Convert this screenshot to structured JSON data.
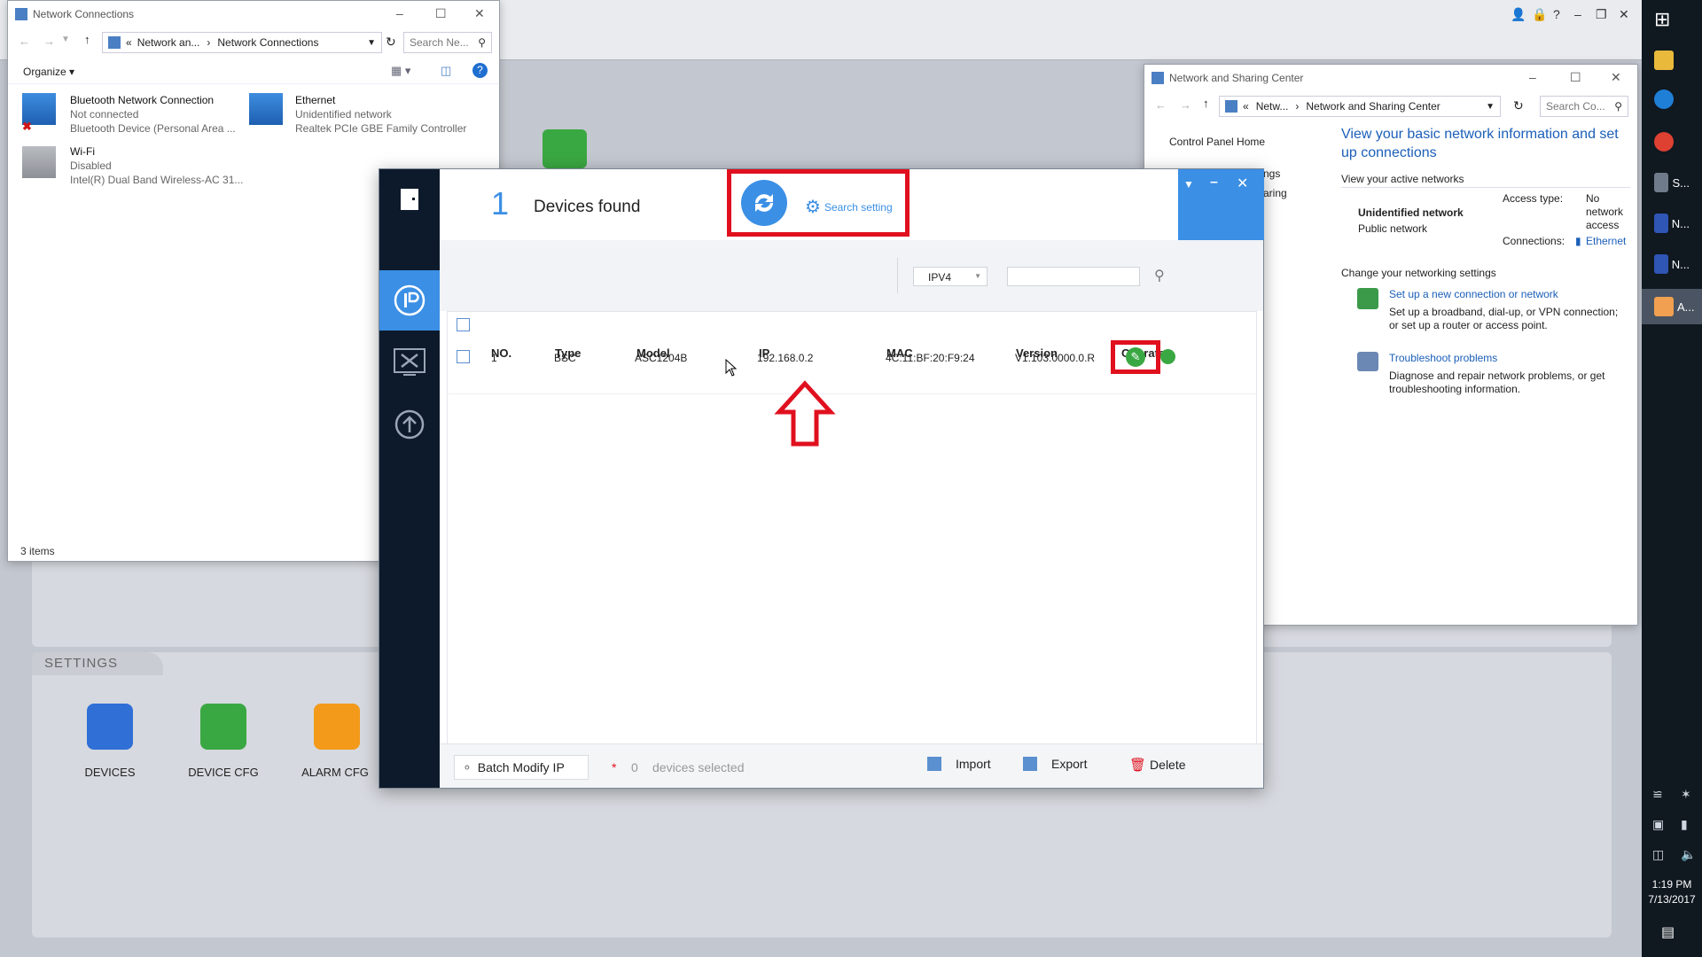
{
  "network_connections": {
    "title": "Network Connections",
    "breadcrumb_prefix": "«",
    "breadcrumb_1": "Network an...",
    "breadcrumb_2": "Network Connections",
    "search_placeholder": "Search Ne...",
    "organize": "Organize",
    "items": [
      {
        "name": "Bluetooth Network Connection",
        "status": "Not connected",
        "device": "Bluetooth Device (Personal Area ..."
      },
      {
        "name": "Ethernet",
        "status": "Unidentified network",
        "device": "Realtek PCIe GBE Family Controller"
      },
      {
        "name": "Wi-Fi",
        "status": "Disabled",
        "device": "Intel(R) Dual Band Wireless-AC 31..."
      }
    ],
    "status_bar": "3 items"
  },
  "sharing_center": {
    "title": "Network and Sharing Center",
    "breadcrumb_prefix": "«",
    "breadcrumb_1": "Netw...",
    "breadcrumb_2": "Network and Sharing Center",
    "search_placeholder": "Search Co...",
    "sidebar_home": "Control Panel Home",
    "sidebar_partial_1": "ngs",
    "sidebar_partial_2": "aring",
    "heading": "View your basic network information and set up connections",
    "active_networks": "View your active networks",
    "network_name": "Unidentified network",
    "network_type": "Public network",
    "access_type_label": "Access type:",
    "access_type_value": "No network access",
    "connections_label": "Connections:",
    "connections_value": "Ethernet",
    "change_settings": "Change your networking settings",
    "setup_link": "Set up a new connection or network",
    "setup_desc": "Set up a broadband, dial-up, or VPN connection; or set up a router or access point.",
    "trouble_link": "Troubleshoot problems",
    "trouble_desc": "Diagnose and repair network problems, or get troubleshooting information."
  },
  "background_app": {
    "settings_label": "SETTINGS",
    "icons": [
      {
        "label": "DEVICES",
        "color": "#2f6fd6"
      },
      {
        "label": "DEVICE CFG",
        "color": "#3aa842"
      },
      {
        "label": "ALARM CFG",
        "color": "#f39a1a"
      }
    ]
  },
  "dialog": {
    "device_count": "1",
    "devices_found": "Devices found",
    "search_setting": "Search setting",
    "ip_version": "IPV4",
    "filter_placeholder": "",
    "columns": [
      "NO.",
      "Type",
      "Model",
      "IP",
      "MAC",
      "Version",
      "Operate"
    ],
    "rows": [
      {
        "no": "1",
        "type": "BSC",
        "model": "ASC1204B",
        "ip": "192.168.0.2",
        "mac": "4C:11:BF:20:F9:24",
        "version": "V1.103.0000.0.R"
      }
    ],
    "batch_modify": "Batch Modify IP",
    "selected_star": "*",
    "selected_count": "0",
    "selected_text": "devices selected",
    "import": "Import",
    "export": "Export",
    "delete": "Delete",
    "accent_color": "#3b8fe5",
    "highlight_color": "#e0101e"
  },
  "taskbar": {
    "items": [
      {
        "label": "S..."
      },
      {
        "label": "N..."
      },
      {
        "label": "N..."
      },
      {
        "label": "A..."
      }
    ],
    "time": "1:19 PM",
    "date": "7/13/2017"
  }
}
